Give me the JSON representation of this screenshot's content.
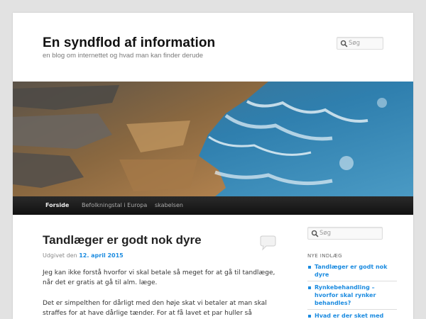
{
  "site": {
    "title": "En syndflod af information",
    "description": "en blog om internettet og hvad man kan finder derude"
  },
  "search": {
    "top_placeholder": "Søg",
    "side_placeholder": "Søg"
  },
  "nav": {
    "items": [
      {
        "label": "Forside",
        "current": true
      },
      {
        "label": "Befolkningstal i Europa",
        "current": false
      },
      {
        "label": "skabelsen",
        "current": false
      }
    ]
  },
  "post": {
    "title": "Tandlæger er godt nok dyre",
    "meta_prefix": "Udgivet den",
    "date": "12. april 2015",
    "paragraphs": [
      "Jeg kan ikke forstå hvorfor vi skal betale så meget for at gå til tandlæge, når det er gratis at gå til alm. læge.",
      "Det er simpelthen for dårligt med den høje skat vi betaler at man skal straffes for at have dårlige tænder. For at få lavet et par huller så"
    ]
  },
  "sidebar": {
    "recent_heading": "NYE INDLÆG",
    "recent_posts": [
      "Tandlæger er godt nok dyre",
      "Rynkebehandling – hvorfor skal rynker behandles?",
      "Hvad er der sket med"
    ]
  },
  "icons": {
    "search": "magnifier-icon",
    "comment": "speech-bubble-icon"
  },
  "colors": {
    "link": "#1b8be0",
    "nav_bg": "#1a1a1a",
    "page_bg": "#e2e2e2"
  }
}
